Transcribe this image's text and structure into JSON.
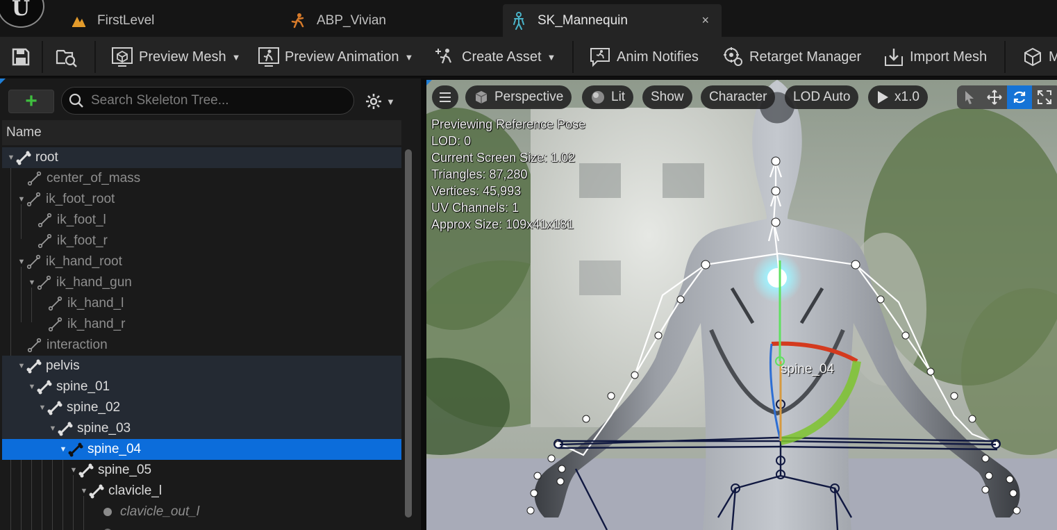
{
  "logo": {
    "glyph": "U"
  },
  "tabs": [
    {
      "label": "FirstLevel",
      "icon": "level-icon"
    },
    {
      "label": "ABP_Vivian",
      "icon": "anim-blueprint-icon"
    },
    {
      "label": "SK_Mannequin",
      "icon": "skeleton-icon",
      "active": true,
      "close": "×"
    }
  ],
  "toolbar": {
    "save_icon": "save-icon",
    "browse_icon": "browse-icon",
    "preview_mesh": "Preview Mesh",
    "preview_animation": "Preview Animation",
    "create_asset": "Create Asset",
    "anim_notifies": "Anim Notifies",
    "retarget_manager": "Retarget Manager",
    "import_mesh": "Import Mesh",
    "overflow": "M"
  },
  "skeleton_tree": {
    "add_label": "+",
    "search_placeholder": "Search Skeleton Tree...",
    "column_name": "Name",
    "rows": [
      {
        "label": "root"
      },
      {
        "label": "center_of_mass"
      },
      {
        "label": "ik_foot_root"
      },
      {
        "label": "ik_foot_l"
      },
      {
        "label": "ik_foot_r"
      },
      {
        "label": "ik_hand_root"
      },
      {
        "label": "ik_hand_gun"
      },
      {
        "label": "ik_hand_l"
      },
      {
        "label": "ik_hand_r"
      },
      {
        "label": "interaction"
      },
      {
        "label": "pelvis"
      },
      {
        "label": "spine_01"
      },
      {
        "label": "spine_02"
      },
      {
        "label": "spine_03"
      },
      {
        "label": "spine_04",
        "selected": true
      },
      {
        "label": "spine_05"
      },
      {
        "label": "clavicle_l"
      },
      {
        "label": "clavicle_out_l"
      }
    ]
  },
  "viewport": {
    "perspective": "Perspective",
    "lit": "Lit",
    "show": "Show",
    "character": "Character",
    "lod": "LOD Auto",
    "speed": "x1.0",
    "stats": {
      "line1": "Previewing Reference Pose",
      "line2": "LOD: 0",
      "line3": "Current Screen Size: 1.02",
      "line4": "Triangles: 87,280",
      "line5": "Vertices: 45,993",
      "line6": "UV Channels: 1",
      "line7": "Approx Size: 109x41x181"
    },
    "selected_bone_label": "spine_04"
  },
  "colors": {
    "accent": "#0c6ddb",
    "selection": "#0c6ddb",
    "add_green": "#3fbf3f"
  }
}
